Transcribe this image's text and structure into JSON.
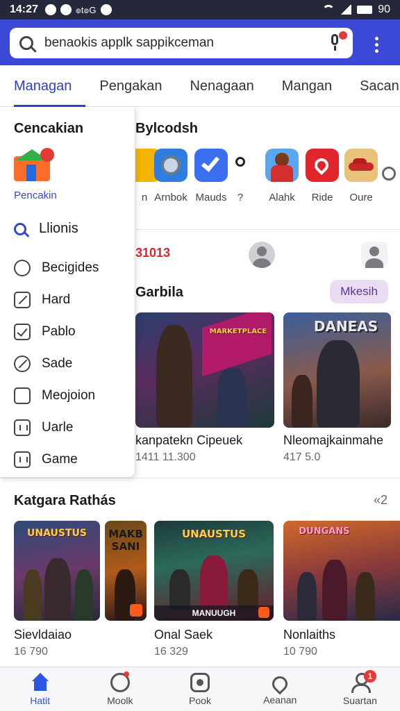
{
  "status_bar": {
    "time": "14:27",
    "carrier": "๏t๏G",
    "battery": "90"
  },
  "search": {
    "value": "benaokis applk sappikceman"
  },
  "tabs": [
    {
      "label": "Managan",
      "active": true
    },
    {
      "label": "Pengakan",
      "active": false
    },
    {
      "label": "Nenagaan",
      "active": false
    },
    {
      "label": "Mangan",
      "active": false
    },
    {
      "label": "Sacan",
      "active": false
    }
  ],
  "drawer": {
    "title": "Cencakian",
    "app_label": "Pencakin",
    "search_label": "Llionis",
    "items": [
      {
        "label": "Becigides",
        "icon": "settings-icon"
      },
      {
        "label": "Hard",
        "icon": "edit-icon"
      },
      {
        "label": "Pablo",
        "icon": "checkbox-icon"
      },
      {
        "label": "Sade",
        "icon": "leaf-icon"
      },
      {
        "label": "Meojoion",
        "icon": "square-icon"
      },
      {
        "label": "Uarle",
        "icon": "bars-icon"
      },
      {
        "label": "Game",
        "icon": "game-icon"
      }
    ]
  },
  "featured": {
    "title": "Bylcodsh",
    "apps": [
      {
        "label": "n",
        "color": "#f4b400"
      },
      {
        "label": "Arnbok",
        "color": "#2f7de0"
      },
      {
        "label": "Mauds",
        "color": "#3a6ff0"
      },
      {
        "label": "?",
        "color": "#ffffff"
      },
      {
        "label": "Alahk",
        "color": "#5aa7f0"
      },
      {
        "label": "Ride",
        "color": "#e0262c"
      },
      {
        "label": "Oure",
        "color": "#e8b04a"
      }
    ]
  },
  "promo": {
    "text": "31013"
  },
  "games": {
    "title": "Garbila",
    "more_label": "Mkesih",
    "cards": [
      {
        "emblem": "MARKETPLACE",
        "title": "kanpatekn Cipeuek",
        "sub": "1411 11.300",
        "tone": "#c23a6a"
      },
      {
        "emblem": "DANEAS",
        "title": "Nleomajkainmahe",
        "sub": "417 5.0",
        "tone": "#4a5aa8"
      }
    ]
  },
  "category": {
    "title": "Katgara Rathás",
    "count": "«2",
    "cards": [
      {
        "emblem": "UNAUSTUS",
        "title": "Sievldaiao",
        "sub": "16 790"
      },
      {
        "emblem": "MAKB SANI",
        "title": "",
        "sub": ""
      },
      {
        "emblem": "UNAUSTUS",
        "caption": "MANUUGH",
        "title": "Onal Saek",
        "sub": "16 329"
      },
      {
        "emblem": "DUNGANS",
        "title": "Nonlaiths",
        "sub": "10 790"
      }
    ]
  },
  "bottom_nav": [
    {
      "label": "Hatit",
      "active": true
    },
    {
      "label": "Moolk",
      "active": false
    },
    {
      "label": "Pook",
      "active": false
    },
    {
      "label": "Aeanan",
      "active": false
    },
    {
      "label": "Suartan",
      "active": false,
      "badge": "1"
    }
  ]
}
